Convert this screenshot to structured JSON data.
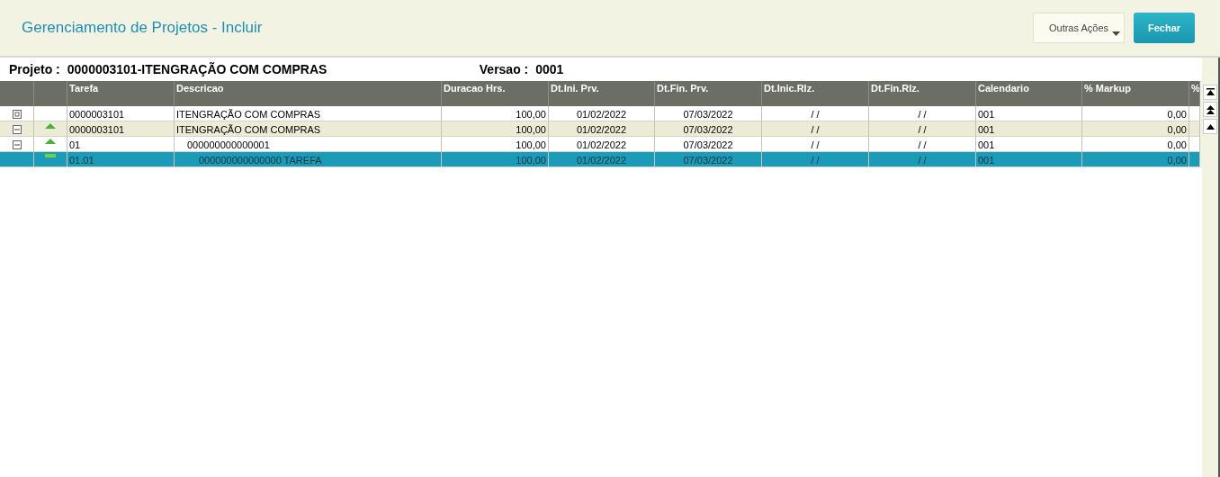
{
  "window": {
    "title": "Gerenciamento de Projetos - Incluir"
  },
  "actions": [
    {
      "kind": "menu",
      "label": "Outras Ações"
    },
    {
      "kind": "primary",
      "label": "Fechar"
    }
  ],
  "project": {
    "label": "Projeto :",
    "value": "0000003101-ITENGRAÇÃO COM COMPRAS",
    "version_label": "Versao :",
    "version": "0001"
  },
  "table": {
    "columns": [
      {
        "label": "Tarefa"
      },
      {
        "label": "Descricao"
      },
      {
        "label": "Duracao Hrs."
      },
      {
        "label": "Dt.Ini. Prv."
      },
      {
        "label": "Dt.Fin. Prv."
      },
      {
        "label": "Dt.Inic.Rlz."
      },
      {
        "label": "Dt.Fin.Rlz."
      },
      {
        "label": "Calendario"
      },
      {
        "label": "% Markup"
      },
      {
        "label": "%"
      }
    ],
    "rows": [
      {
        "kind": "project",
        "selected": false,
        "cells": [
          "0000003101",
          "ITENGRAÇÃO COM COMPRAS",
          "100,00",
          "01/02/2022",
          "07/03/2022",
          "/ /",
          "/ /",
          "001",
          "0,00"
        ]
      },
      {
        "kind": "phase",
        "selected": false,
        "cells": [
          "0000003101",
          "ITENGRAÇÃO COM COMPRAS",
          "100,00",
          "01/02/2022",
          "07/03/2022",
          "/ /",
          "/ /",
          "001",
          "0,00"
        ],
        "children": [
          {
            "kind": "phase",
            "selected": false,
            "cells": [
              "01",
              "000000000000001",
              "100,00",
              "01/02/2022",
              "07/03/2022",
              "/ /",
              "/ /",
              "001",
              "0,00"
            ],
            "children": [
              {
                "kind": "task",
                "selected": true,
                "cells": [
                  "01.01",
                  "000000000000000 TAREFA",
                  "100,00",
                  "01/02/2022",
                  "07/03/2022",
                  "/ /",
                  "/ /",
                  "001",
                  "0,00"
                ]
              }
            ]
          }
        ]
      }
    ]
  }
}
